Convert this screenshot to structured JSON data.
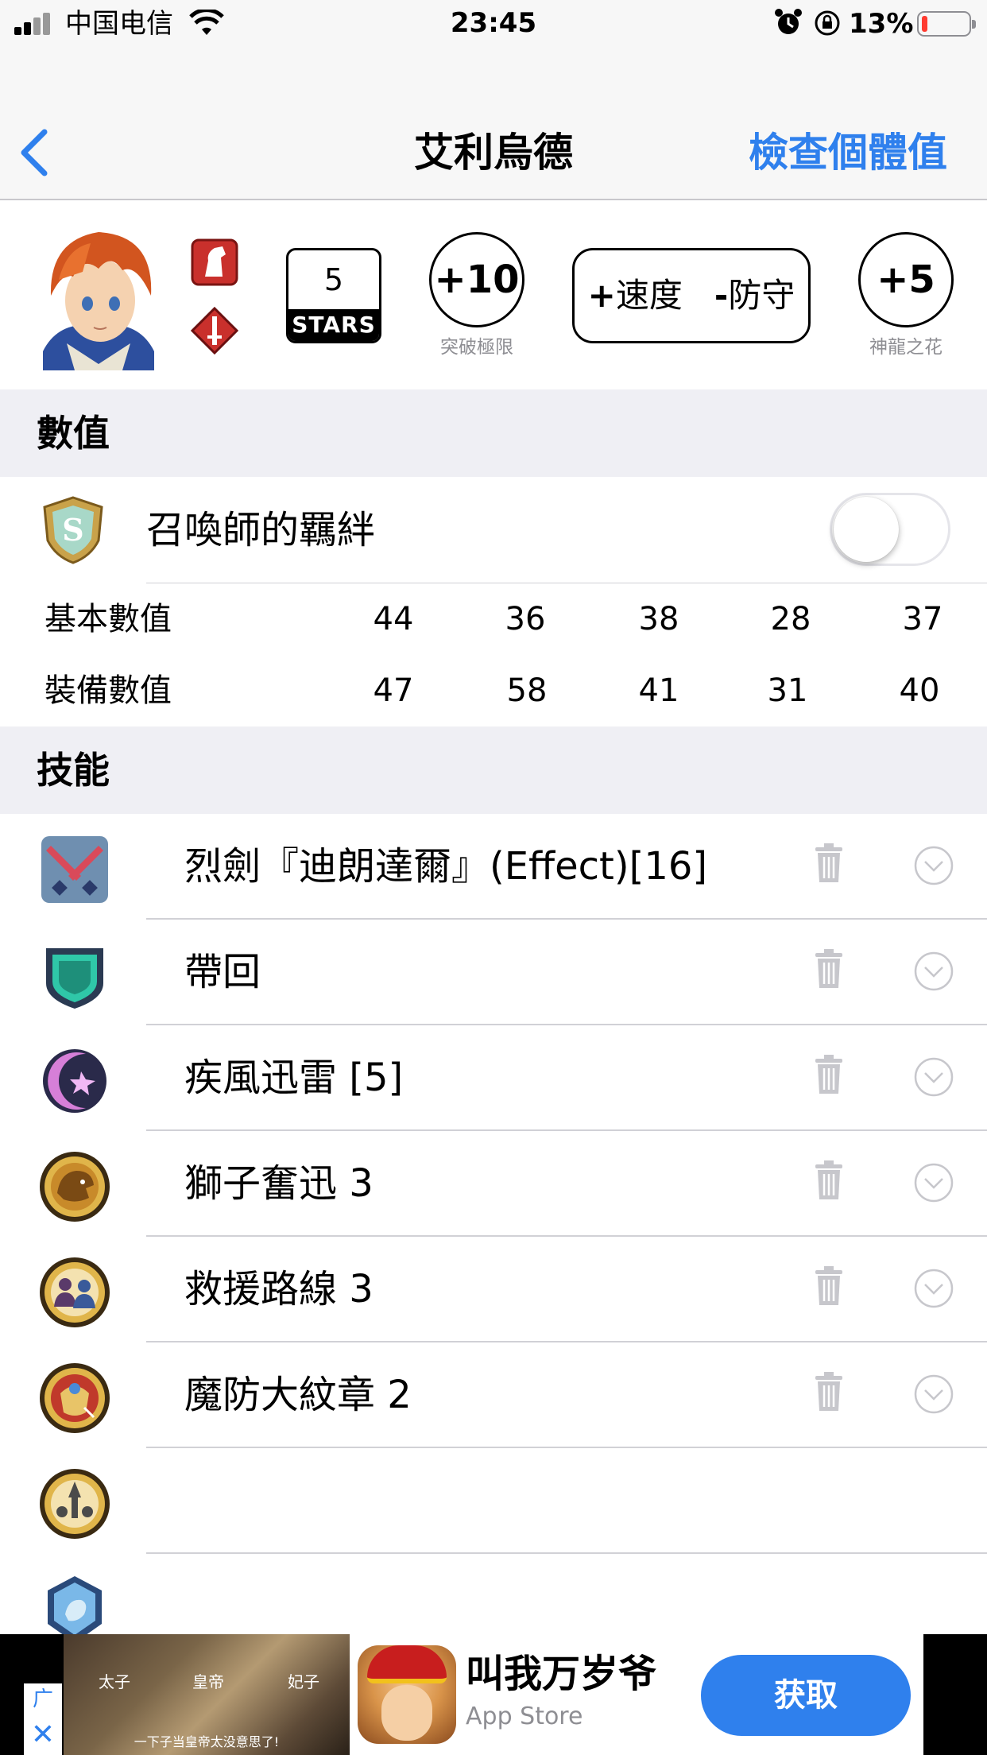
{
  "status_bar": {
    "carrier": "中国电信",
    "time": "23:45",
    "battery_percent": "13%",
    "battery_level": 0.13
  },
  "nav": {
    "back_icon": "chevron-left-icon",
    "title": "艾利烏德",
    "action": "檢查個體值"
  },
  "hero": {
    "stars_value": "5",
    "stars_label": "STARS",
    "merges_value": "+10",
    "merges_caption": "突破極限",
    "boon_sign": "+",
    "boon": "速度",
    "bane_sign": "-",
    "bane": "防守",
    "flowers_value": "+5",
    "flowers_caption": "神龍之花",
    "accent_color": "#2f80ed"
  },
  "sections": {
    "stats_title": "數值",
    "skills_title": "技能"
  },
  "summoner_support": {
    "label": "召喚師的羈絆",
    "enabled": false
  },
  "stats": {
    "base_label": "基本數值",
    "base_values": [
      "44",
      "36",
      "38",
      "28",
      "37"
    ],
    "equipped_label": "裝備數值",
    "equipped_values": [
      "47",
      "58",
      "41",
      "31",
      "40"
    ]
  },
  "skills": [
    {
      "icon": "weapon-skill-icon",
      "name": "烈劍『迪朗達爾』(Effect)[16]"
    },
    {
      "icon": "assist-skill-icon",
      "name": "帶回"
    },
    {
      "icon": "special-skill-icon",
      "name": "疾風迅雷 [5]"
    },
    {
      "icon": "passive-a-icon",
      "name": "獅子奮迅 3"
    },
    {
      "icon": "passive-b-icon",
      "name": "救援路線 3"
    },
    {
      "icon": "passive-c-icon",
      "name": "魔防大紋章 2"
    },
    {
      "icon": "sacred-seal-icon",
      "name": ""
    },
    {
      "icon": "empty-skill-icon",
      "name": ""
    }
  ],
  "ad": {
    "label": "广告",
    "close_icon": "close-icon",
    "image_text_left": "太子",
    "image_text_center": "皇帝",
    "image_text_right": "妃子",
    "image_caption": "一下子当皇帝太没意思了!",
    "app_title": "叫我万岁爷",
    "app_subtitle": "App Store",
    "cta": "获取"
  }
}
